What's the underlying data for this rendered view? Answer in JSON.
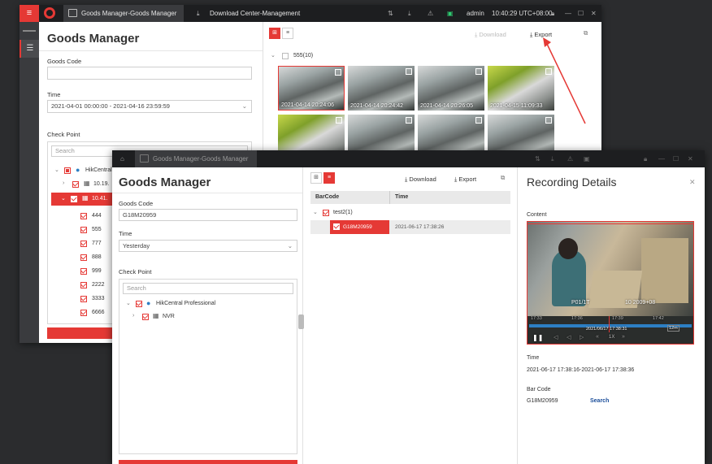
{
  "back_window": {
    "tabs": [
      {
        "label": "Goods Manager-Goods Manager"
      },
      {
        "label": "Download Center-Management"
      }
    ],
    "user": "admin",
    "clock": "10:40:29 UTC+08:00",
    "title": "Goods Manager",
    "goods_code_label": "Goods Code",
    "goods_code_value": "",
    "time_label": "Time",
    "time_value": "2021-04-01 00:00:00 - 2021-04-16 23:59:59",
    "checkpoint_label": "Check Point",
    "search_placeholder": "Search",
    "tree": {
      "root": "HikCentral",
      "node1": "10.19.",
      "node2": "10.41.",
      "leaves": [
        "444",
        "555",
        "777",
        "888",
        "999",
        "2222",
        "3333",
        "6666"
      ]
    },
    "toolbar": {
      "download": "Download",
      "export": "Export"
    },
    "group": "555(10)",
    "thumbs": [
      {
        "stamp": "2021-04-14 20:24:06"
      },
      {
        "stamp": "2021-04-14 20:24:42"
      },
      {
        "stamp": "2021-04-14 20:26:05"
      },
      {
        "stamp": "2021-04-15 11:09:33"
      }
    ]
  },
  "front_window": {
    "tab": "Goods Manager-Goods Manager",
    "title": "Goods Manager",
    "goods_code_label": "Goods Code",
    "goods_code_value": "G18M20959",
    "time_label": "Time",
    "time_value": "Yesterday",
    "checkpoint_label": "Check Point",
    "search_placeholder": "Search",
    "tree": {
      "root": "HikCentral Professional",
      "child": "NVR"
    },
    "toolbar": {
      "download": "Download",
      "export": "Export"
    },
    "columns": {
      "barcode": "BarCode",
      "time": "Time"
    },
    "group": "test2(1)",
    "row": {
      "barcode": "G18M20959",
      "time": "2021-06-17 17:38:26"
    }
  },
  "details": {
    "title": "Recording Details",
    "content_label": "Content",
    "video_overlay_left": "P01/1T",
    "video_overlay_right": "10 2009+08",
    "timeline_stamp": "2021/06/17 17:38:31",
    "timeline_ticks": [
      "17:33",
      "17:36",
      "17:39",
      "17:42"
    ],
    "zoom": "12m",
    "speed": "1X",
    "time_label": "Time",
    "time_value": "2021-06-17 17:38:16-2021-06-17 17:38:36",
    "barcode_label": "Bar Code",
    "barcode_value": "G18M20959",
    "search_link": "Search"
  },
  "colors": {
    "accent": "#e53935",
    "titlebar": "#1d1e20",
    "link": "#1a4d9a"
  }
}
